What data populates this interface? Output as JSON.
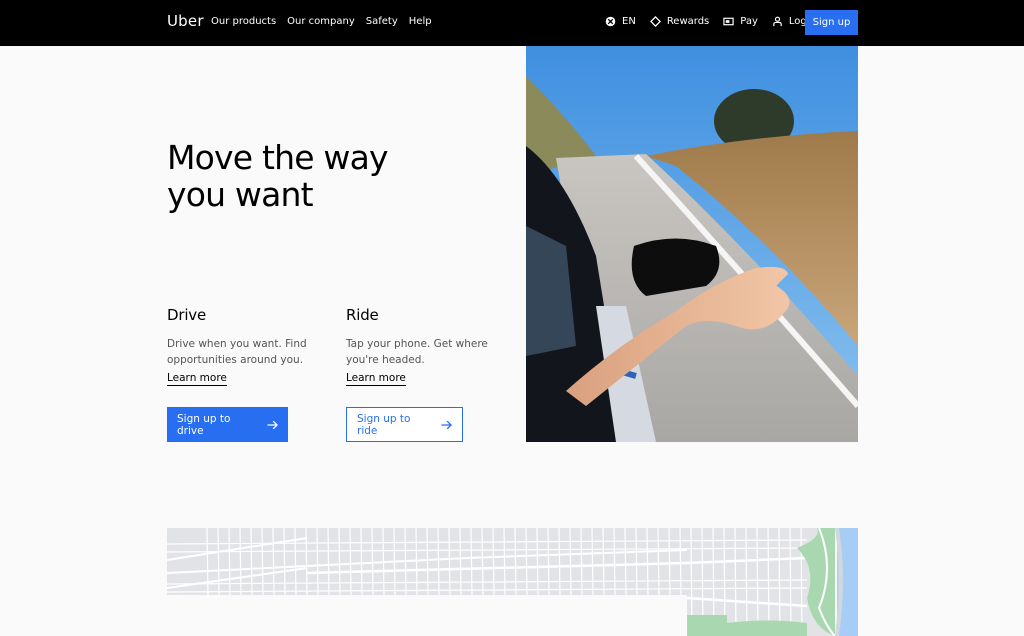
{
  "header": {
    "logo": "Uber",
    "nav_left": [
      "Our products",
      "Our company",
      "Safety",
      "Help"
    ],
    "nav_right": [
      {
        "label": "EN",
        "icon": "globe-icon"
      },
      {
        "label": "Rewards",
        "icon": "diamond-icon"
      },
      {
        "label": "Pay",
        "icon": "wallet-icon"
      },
      {
        "label": "Log in",
        "icon": "person-icon"
      }
    ],
    "signup_label": "Sign up"
  },
  "hero": {
    "title_line1": "Move the way",
    "title_line2": "you want",
    "photo_alt": "Hand out of car window on a sunny road",
    "drive": {
      "title": "Drive",
      "description": "Drive when you want. Find opportunities around you.",
      "learn_more": "Learn more",
      "button_label": "Sign up to drive"
    },
    "ride": {
      "title": "Ride",
      "description": "Tap your phone. Get where you're headed.",
      "learn_more": "Learn more",
      "button_label": "Sign up to ride"
    }
  },
  "colors": {
    "brand_blue": "#276ef1",
    "header_bg": "#000000",
    "page_bg": "#fafafa",
    "map_land": "#e2e3e6",
    "map_park": "#a9d8b0",
    "map_water": "#a7cdf7"
  }
}
